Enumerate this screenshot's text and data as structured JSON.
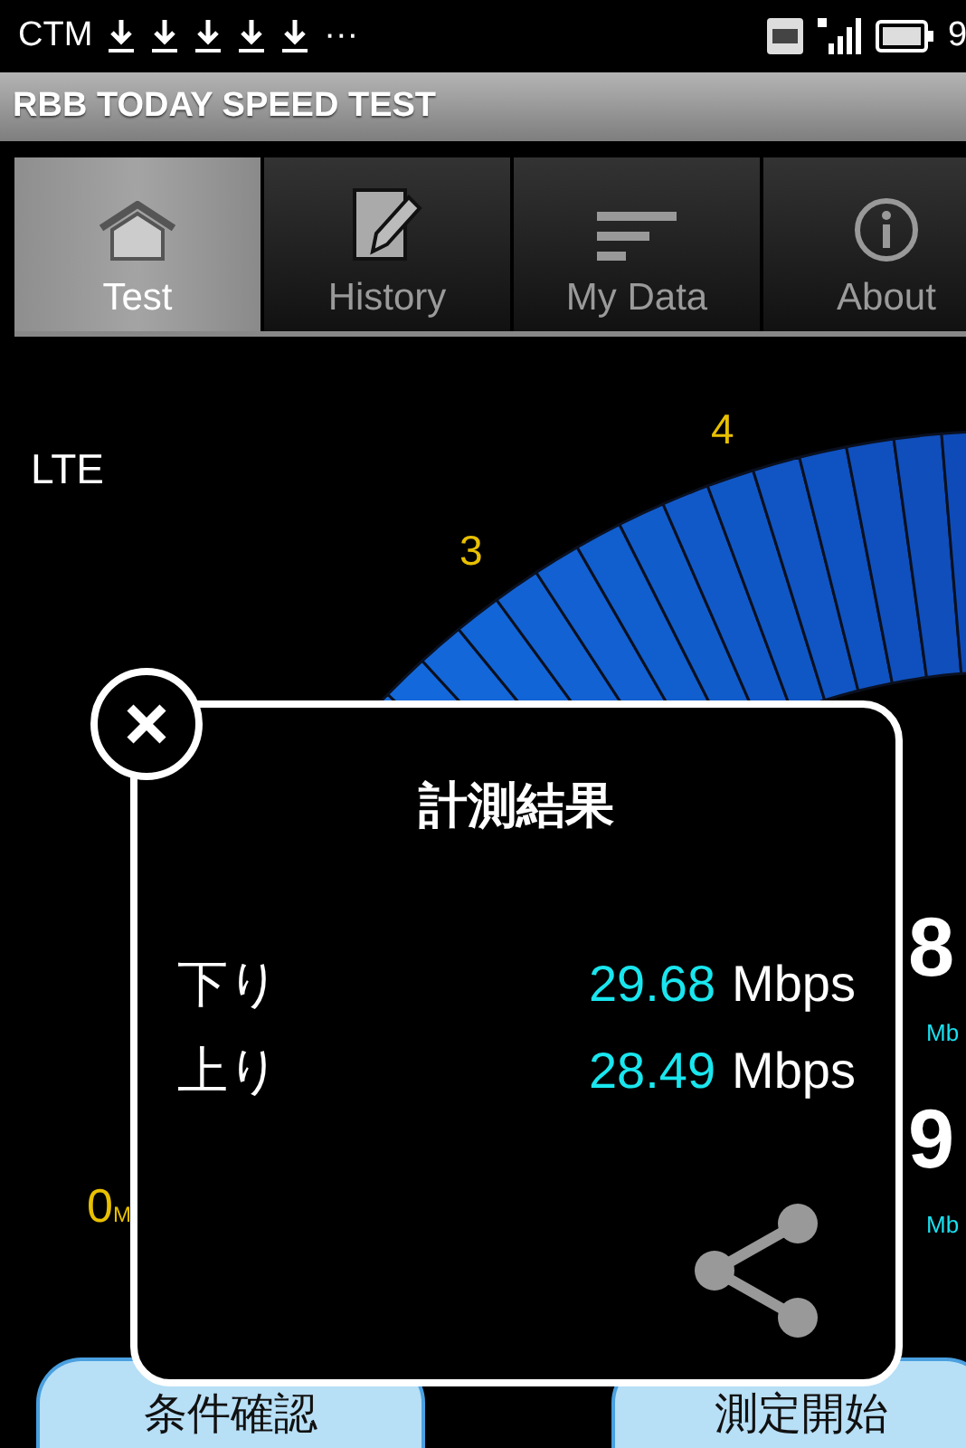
{
  "status_bar": {
    "carrier": "CTM",
    "more": "···",
    "time": "9"
  },
  "app_title": "RBB TODAY SPEED TEST",
  "tabs": [
    {
      "label": "Test",
      "selected": true
    },
    {
      "label": "History",
      "selected": false
    },
    {
      "label": "My Data",
      "selected": false
    },
    {
      "label": "About",
      "selected": false
    }
  ],
  "network": "LTE",
  "gauge": {
    "labels": [
      "3",
      "4"
    ],
    "zero": "0",
    "zero_unit": "M"
  },
  "readings": [
    {
      "value": "8",
      "unit": "Mb"
    },
    {
      "value": "9",
      "unit": "Mb"
    }
  ],
  "buttons": [
    "条件確認",
    "測定開始"
  ],
  "dialog": {
    "title": "計測結果",
    "rows": [
      {
        "label": "下り",
        "value": "29.68",
        "unit": "Mbps"
      },
      {
        "label": "上り",
        "value": "28.49",
        "unit": "Mbps"
      }
    ]
  }
}
